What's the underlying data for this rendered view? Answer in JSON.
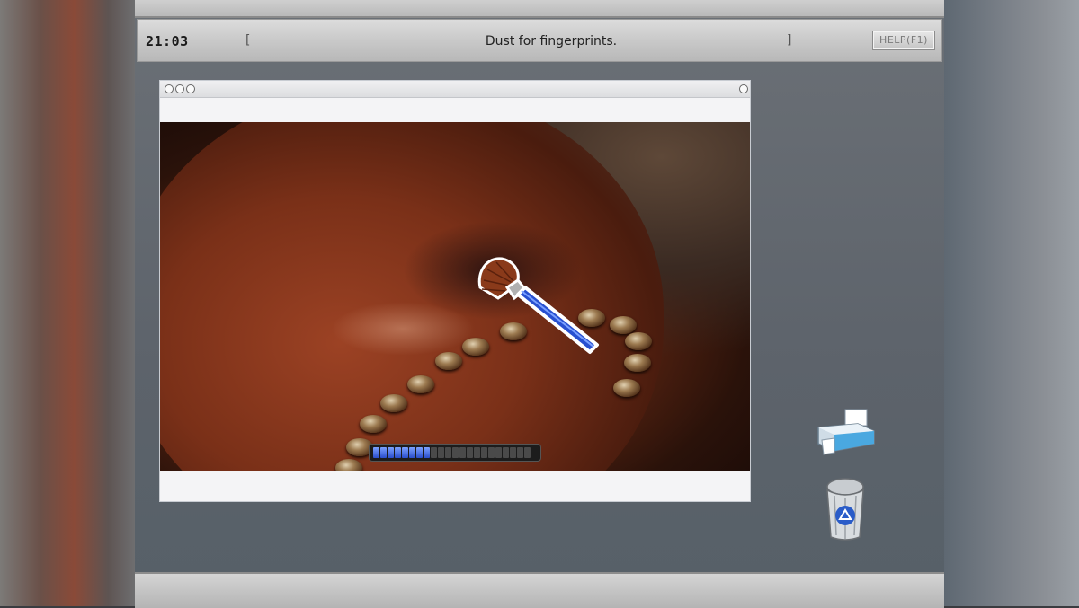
{
  "topbar": {
    "clock": "21:03",
    "bracket_open": "[",
    "task": "Dust for fingerprints.",
    "bracket_close": "]",
    "help_label": "HELP(F1)"
  },
  "viewer": {
    "progress_fraction": 0.36,
    "tool_icon": "dusting-brush-icon"
  },
  "desktop_icons": [
    "printer-icon",
    "recycle-bin-icon"
  ],
  "colors": {
    "progress_fill": "#2a4ecc",
    "brush_handle": "#2850d0"
  }
}
